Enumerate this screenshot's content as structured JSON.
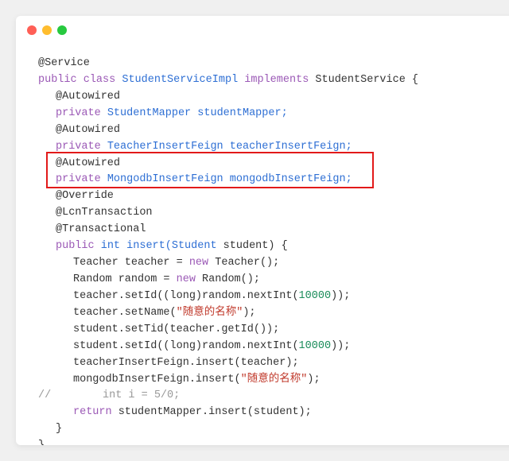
{
  "code": {
    "annotation_service": "@Service",
    "class_decl_1": "public",
    "class_decl_2": "class",
    "class_name": "StudentServiceImpl",
    "implements_kw": "implements",
    "interface_name": "StudentService {",
    "autowired_1": "@Autowired",
    "field1_private": "private",
    "field1_type": "StudentMapper",
    "field1_name": "studentMapper;",
    "autowired_2": "@Autowired",
    "field2_private": "private",
    "field2_type": "TeacherInsertFeign",
    "field2_name": "teacherInsertFeign;",
    "autowired_3": "@Autowired",
    "field3_private": "private",
    "field3_type": "MongodbInsertFeign",
    "field3_name": "mongodbInsertFeign;",
    "override": "@Override",
    "lcn": "@LcnTransaction",
    "transactional": "@Transactional",
    "method_public": "public",
    "method_ret": "int",
    "method_name": "insert(Student",
    "method_param": "student) {",
    "l1a": "Teacher teacher = ",
    "l1_new": "new",
    "l1b": " Teacher();",
    "l2a": "Random random = ",
    "l2_new": "new",
    "l2b": " Random();",
    "l3a": "teacher.setId((long)random.nextInt(",
    "l3_num": "10000",
    "l3b": "));",
    "l4a": "teacher.setName(",
    "l4_str": "\"随意的名称\"",
    "l4b": ");",
    "l5": "student.setTid(teacher.getId());",
    "l6a": "student.setId((long)random.nextInt(",
    "l6_num": "10000",
    "l6b": "));",
    "l7": "teacherInsertFeign.insert(teacher);",
    "l8a": "mongodbInsertFeign.insert(",
    "l8_str": "\"随意的名称\"",
    "l8b": ");",
    "comment_line": "//        int i = 5/0;",
    "return_kw": "return",
    "return_rest": " studentMapper.insert(student);",
    "close_method": "}",
    "close_class": "}"
  }
}
